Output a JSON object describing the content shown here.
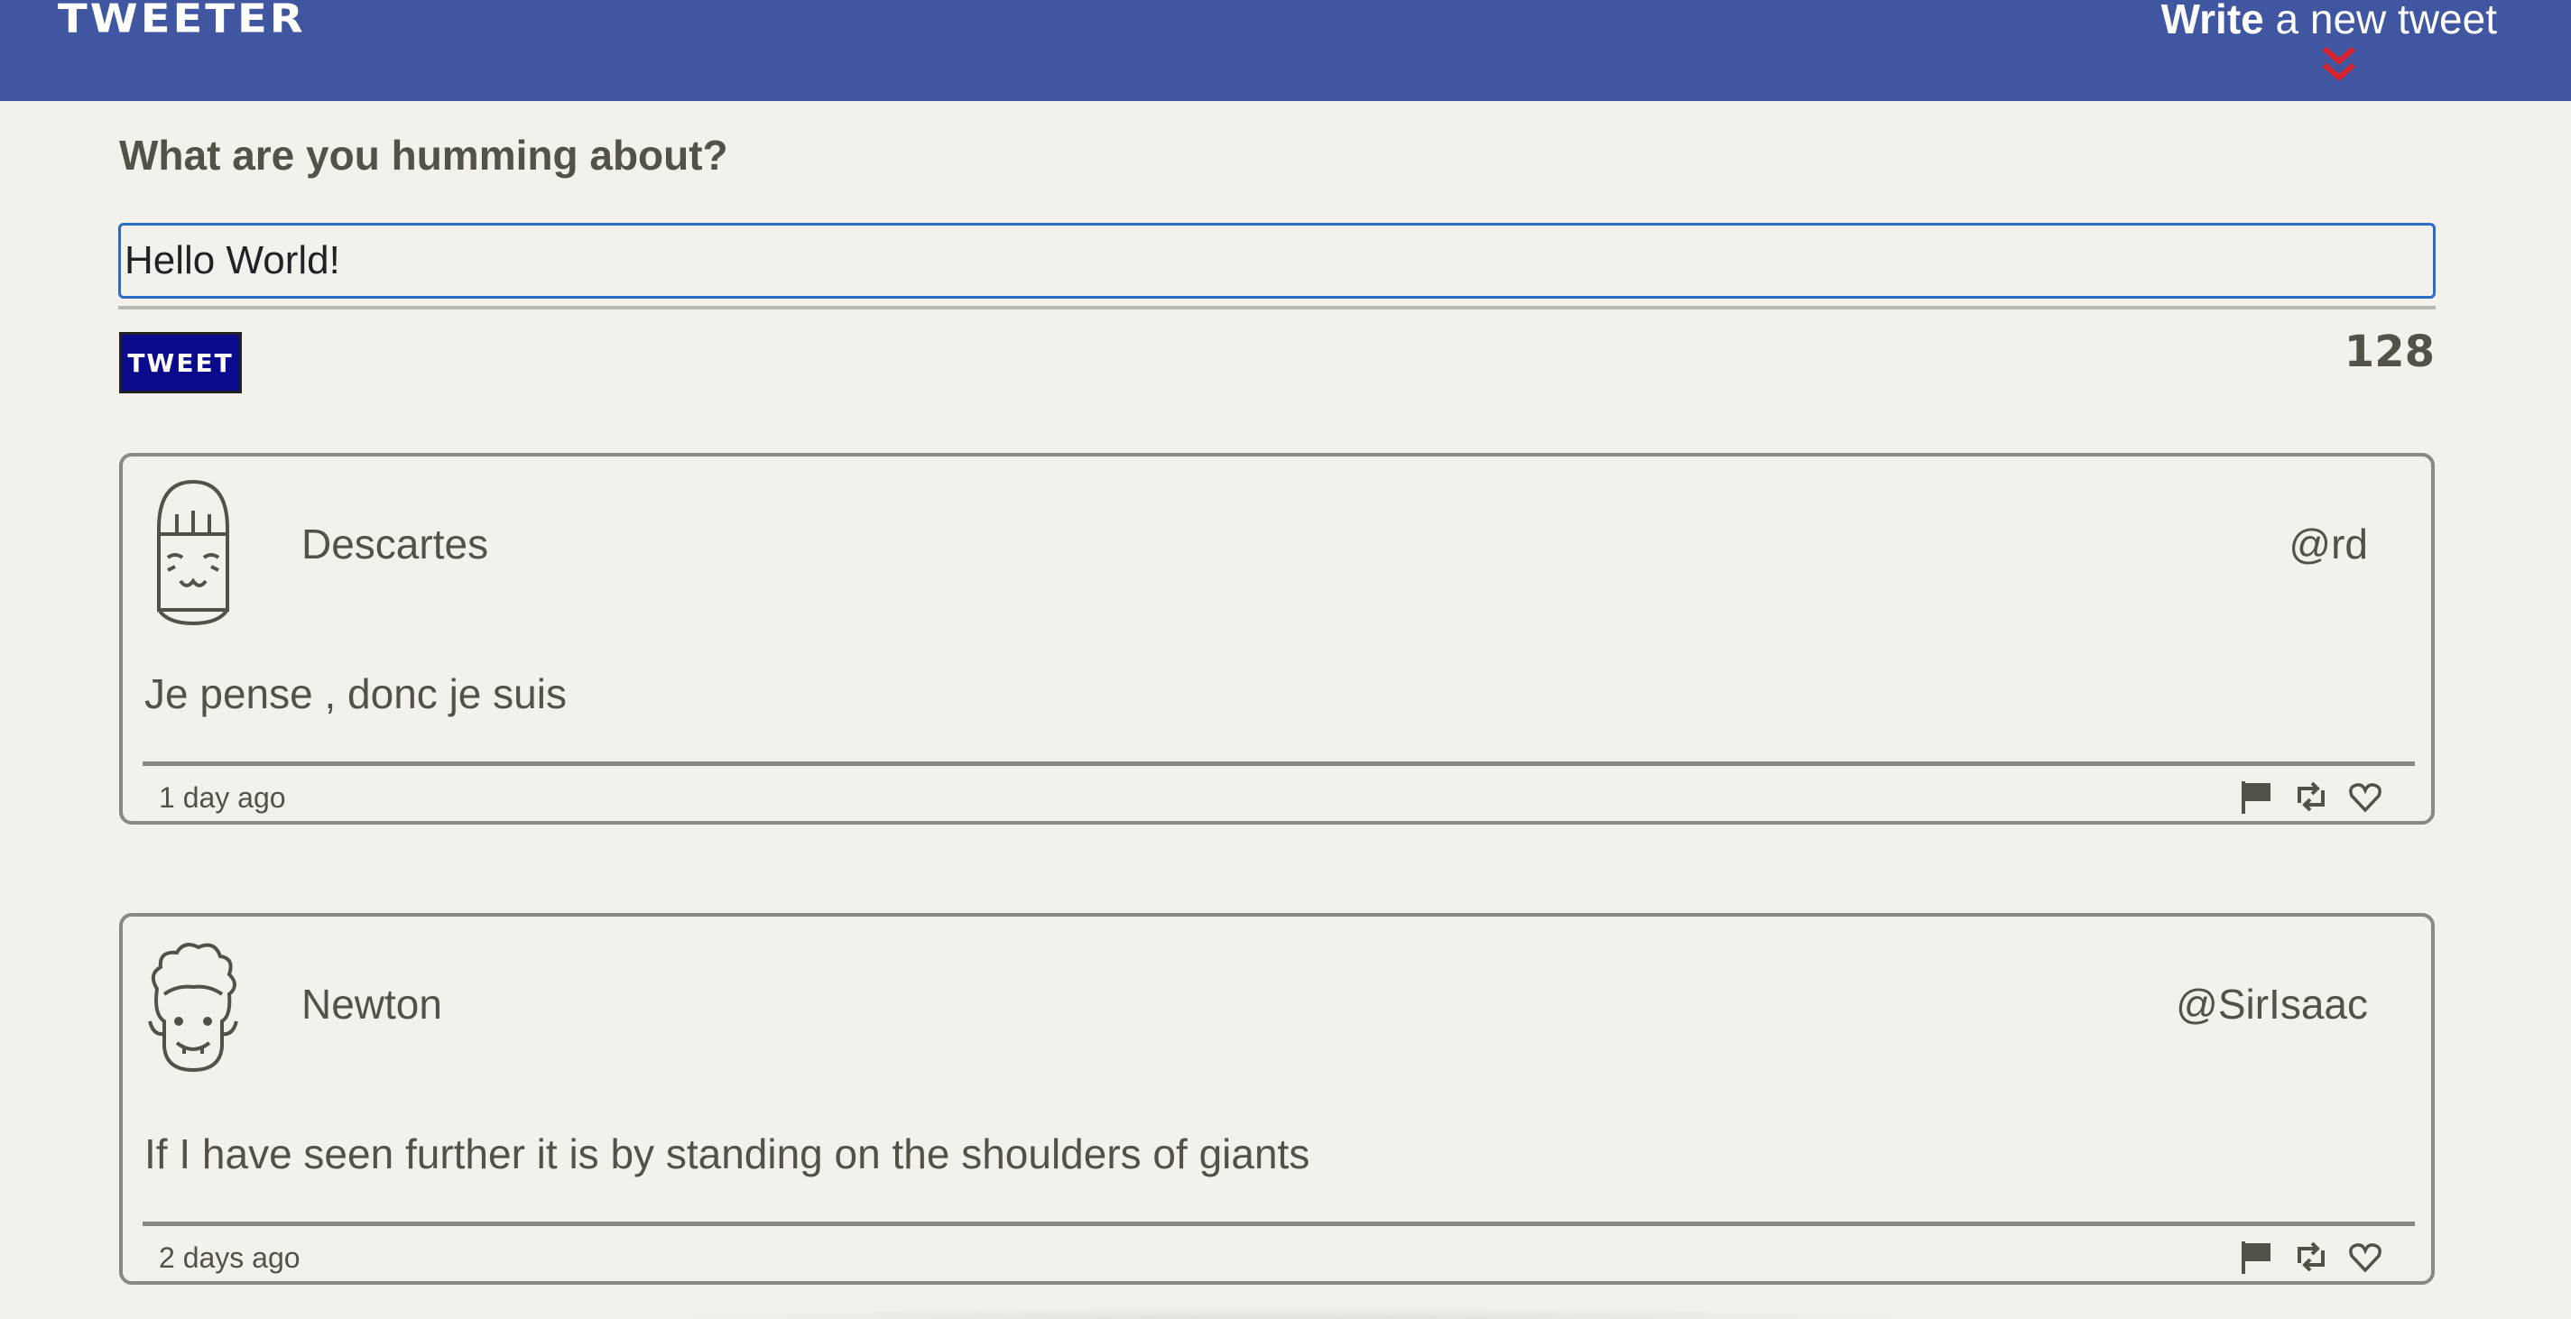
{
  "header": {
    "brand": "TWEETER",
    "write_bold": "Write",
    "write_rest": " a new tweet",
    "chevron_icon": "double-chevron-down-icon",
    "chevron_color": "#d9232e",
    "background": "#4056a1"
  },
  "composer": {
    "title": "What are you humming about?",
    "input_value": "Hello World!",
    "button_label": "TWEET",
    "char_count": "128"
  },
  "tweets": [
    {
      "name": "Descartes",
      "handle": "@rd",
      "text": "Je pense , donc je suis",
      "time": "1 day ago",
      "avatar_icon": "girl-face-avatar-icon"
    },
    {
      "name": "Newton",
      "handle": "@SirIsaac",
      "text": "If I have seen further it is by standing on the shoulders of giants",
      "time": "2 days ago",
      "avatar_icon": "curly-hair-face-avatar-icon"
    }
  ],
  "actions": [
    "flag-icon",
    "retweet-icon",
    "heart-icon"
  ]
}
